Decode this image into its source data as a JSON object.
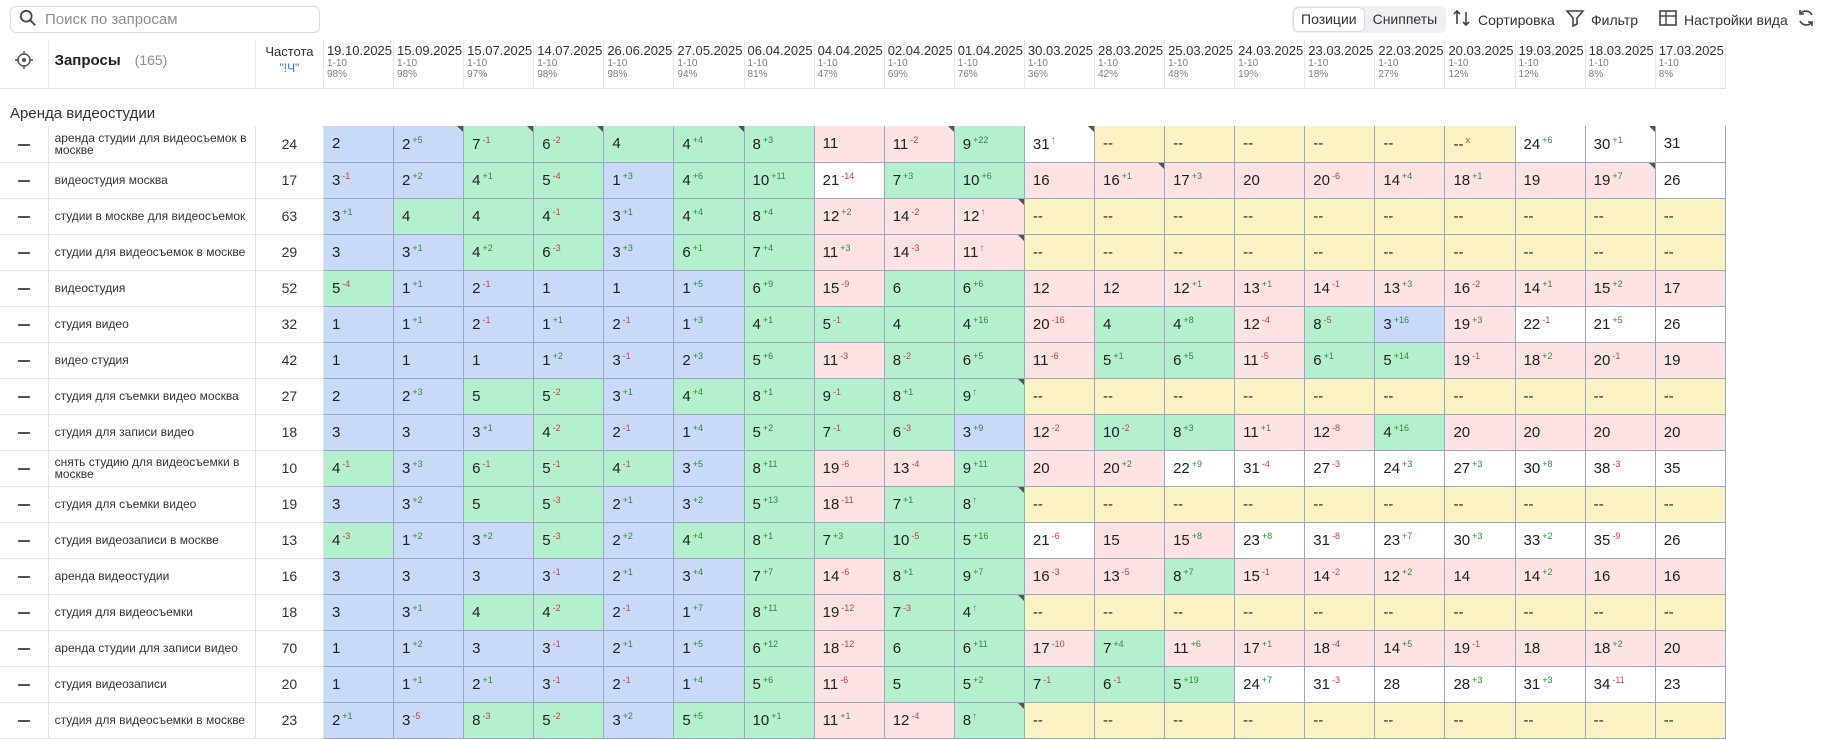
{
  "search": {
    "placeholder": "Поиск по запросам"
  },
  "view_toggle": {
    "positions": "Позиции",
    "snippets": "Сниппеты"
  },
  "toolbar": {
    "sort": "Сортировка",
    "filter": "Фильтр",
    "view_settings": "Настройки вида"
  },
  "header": {
    "query_title": "Запросы",
    "query_count": "(165)",
    "freq_title": "Частота",
    "freq_sub": "\"!Ч\"",
    "dates": [
      {
        "date": "19.10.2025",
        "range": "1-10",
        "pct": "98%"
      },
      {
        "date": "15.09.2025",
        "range": "1-10",
        "pct": "98%"
      },
      {
        "date": "15.07.2025",
        "range": "1-10",
        "pct": "97%"
      },
      {
        "date": "14.07.2025",
        "range": "1-10",
        "pct": "98%"
      },
      {
        "date": "26.06.2025",
        "range": "1-10",
        "pct": "98%"
      },
      {
        "date": "27.05.2025",
        "range": "1-10",
        "pct": "94%"
      },
      {
        "date": "06.04.2025",
        "range": "1-10",
        "pct": "81%"
      },
      {
        "date": "04.04.2025",
        "range": "1-10",
        "pct": "47%"
      },
      {
        "date": "02.04.2025",
        "range": "1-10",
        "pct": "69%"
      },
      {
        "date": "01.04.2025",
        "range": "1-10",
        "pct": "76%"
      },
      {
        "date": "30.03.2025",
        "range": "1-10",
        "pct": "36%"
      },
      {
        "date": "28.03.2025",
        "range": "1-10",
        "pct": "42%"
      },
      {
        "date": "25.03.2025",
        "range": "1-10",
        "pct": "48%"
      },
      {
        "date": "24.03.2025",
        "range": "1-10",
        "pct": "19%"
      },
      {
        "date": "23.03.2025",
        "range": "1-10",
        "pct": "18%"
      },
      {
        "date": "22.03.2025",
        "range": "1-10",
        "pct": "27%"
      },
      {
        "date": "20.03.2025",
        "range": "1-10",
        "pct": "12%"
      },
      {
        "date": "19.03.2025",
        "range": "1-10",
        "pct": "12%"
      },
      {
        "date": "18.03.2025",
        "range": "1-10",
        "pct": "8%"
      },
      {
        "date": "17.03.2025",
        "range": "1-10",
        "pct": "8%"
      }
    ]
  },
  "group": {
    "title": "Аренда видеостудии"
  },
  "colors": {
    "blue": "#c9daf8",
    "green": "#b4f0cd",
    "pink": "#fde3e3",
    "yellow": "#fbf3c3",
    "white": "#ffffff"
  },
  "rows": [
    {
      "query": "аренда студии для видеосъемок в москве",
      "freq": "24",
      "cells": [
        "2",
        "2|+5|c",
        "7|-1|c",
        "6|-2|c",
        "4",
        "4|+4|c",
        "8|+3",
        "11",
        "11|-2|c",
        "9|+22",
        "31|^|c",
        "--",
        "--",
        "--",
        "--",
        "--",
        "--|x",
        "24|+6",
        "30|+1|c",
        "31"
      ]
    },
    {
      "query": "видеостудия москва",
      "freq": "17",
      "cells": [
        "3|-1",
        "2|+2",
        "4|+1",
        "5|-4",
        "1|+3",
        "4|+6",
        "10|+11",
        "21|-14",
        "7|+3",
        "10|+6",
        "16",
        "16|+1|c",
        "17|+3",
        "20",
        "20|-6",
        "14|+4",
        "18|+1",
        "19",
        "19|+7|c",
        "26"
      ]
    },
    {
      "query": "студии в москве для видеосъемок",
      "freq": "63",
      "cells": [
        "3|+1",
        "4|||c",
        "4",
        "4|-1",
        "3|+1",
        "4|+4",
        "8|+4",
        "12|+2",
        "14|-2",
        "12|^|c",
        "--",
        "--",
        "--",
        "--",
        "--",
        "--",
        "--",
        "--",
        "--",
        "--"
      ]
    },
    {
      "query": "студии для видеосъемок в москве",
      "freq": "29",
      "cells": [
        "3",
        "3|+1",
        "4|+2",
        "6|-3",
        "3|+3",
        "6|+1",
        "7|+4",
        "11|+3",
        "14|-3",
        "11|^|c",
        "--",
        "--",
        "--",
        "--",
        "--",
        "--",
        "--",
        "--",
        "--",
        "--"
      ]
    },
    {
      "query": "видеостудия",
      "freq": "52",
      "cells": [
        "5|-4",
        "1|+1",
        "2|-1",
        "1",
        "1",
        "1|+5",
        "6|+9",
        "15|-9",
        "6",
        "6|+6",
        "12",
        "12",
        "12|+1",
        "13|+1",
        "14|-1",
        "13|+3",
        "16|-2",
        "14|+1",
        "15|+2",
        "17"
      ]
    },
    {
      "query": "студия видео",
      "freq": "32",
      "cells": [
        "1",
        "1|+1",
        "2|-1",
        "1|+1",
        "2|-1",
        "1|+3",
        "4|+1",
        "5|-1",
        "4",
        "4|+16",
        "20|-16",
        "4",
        "4|+8",
        "12|-4",
        "8|-5",
        "3|+16",
        "19|+3",
        "22|-1",
        "21|+5",
        "26"
      ]
    },
    {
      "query": "видео студия",
      "freq": "42",
      "cells": [
        "1",
        "1",
        "1",
        "1|+2",
        "3|-1",
        "2|+3",
        "5|+6",
        "11|-3",
        "8|-2",
        "6|+5",
        "11|-6",
        "5|+1",
        "6|+5",
        "11|-5",
        "6|+1",
        "5|+14",
        "19|-1",
        "18|+2",
        "20|-1",
        "19"
      ]
    },
    {
      "query": "студия для съемки видео москва",
      "freq": "27",
      "cells": [
        "2",
        "2|+3",
        "5",
        "5|-2",
        "3|+1",
        "4|+4",
        "8|+1",
        "9|-1",
        "8|+1",
        "9|^|c",
        "--",
        "--",
        "--",
        "--",
        "--",
        "--",
        "--",
        "--",
        "--",
        "--"
      ]
    },
    {
      "query": "студия для записи видео",
      "freq": "18",
      "cells": [
        "3",
        "3",
        "3|+1",
        "4|-2",
        "2|-1",
        "1|+4",
        "5|+2",
        "7|-1",
        "6|-3",
        "3|+9",
        "12|-2",
        "10|-2",
        "8|+3",
        "11|+1",
        "12|-8",
        "4|+16",
        "20",
        "20",
        "20",
        "20"
      ]
    },
    {
      "query": "снять студию для видеосъемки в москве",
      "freq": "10",
      "cells": [
        "4|-1",
        "3|+3",
        "6|-1",
        "5|-1",
        "4|-1",
        "3|+5",
        "8|+11",
        "19|-6",
        "13|-4",
        "9|+11",
        "20",
        "20|+2",
        "22|+9",
        "31|-4",
        "27|-3",
        "24|+3",
        "27|+3",
        "30|+8",
        "38|-3",
        "35"
      ]
    },
    {
      "query": "студия для съемки видео",
      "freq": "19",
      "cells": [
        "3",
        "3|+2",
        "5",
        "5|-3",
        "2|+1",
        "3|+2",
        "5|+13",
        "18|-11",
        "7|+1",
        "8|^|c",
        "--",
        "--",
        "--",
        "--",
        "--",
        "--",
        "--",
        "--",
        "--",
        "--"
      ]
    },
    {
      "query": "студия видеозаписи в москве",
      "freq": "13",
      "cells": [
        "4|-3",
        "1|+2",
        "3|+2",
        "5|-3",
        "2|+2",
        "4|+4",
        "8|+1",
        "7|+3",
        "10|-5",
        "5|+16",
        "21|-6",
        "15",
        "15|+8",
        "23|+8",
        "31|-8",
        "23|+7",
        "30|+3",
        "33|+2",
        "35|-9",
        "26"
      ]
    },
    {
      "query": "аренда видеостудии",
      "freq": "16",
      "cells": [
        "3",
        "3",
        "3",
        "3|-1",
        "2|+1",
        "3|+4",
        "7|+7",
        "14|-6",
        "8|+1",
        "9|+7",
        "16|-3",
        "13|-5",
        "8|+7",
        "15|-1",
        "14|-2",
        "12|+2",
        "14",
        "14|+2",
        "16",
        "16"
      ]
    },
    {
      "query": "студия для видеосъемки",
      "freq": "18",
      "cells": [
        "3",
        "3|+1",
        "4",
        "4|-2",
        "2|-1",
        "1|+7",
        "8|+11",
        "19|-12",
        "7|-3",
        "4|^|c",
        "--",
        "--",
        "--",
        "--",
        "--",
        "--",
        "--",
        "--",
        "--",
        "--"
      ]
    },
    {
      "query": "аренда студии для записи видео",
      "freq": "70",
      "cells": [
        "1",
        "1|+2",
        "3",
        "3|-1",
        "2|+1",
        "1|+5",
        "6|+12",
        "18|-12",
        "6",
        "6|+11",
        "17|-10",
        "7|+4",
        "11|+6",
        "17|+1",
        "18|-4",
        "14|+5",
        "19|-1",
        "18",
        "18|+2",
        "20"
      ]
    },
    {
      "query": "студия видеозаписи",
      "freq": "20",
      "cells": [
        "1",
        "1|+1",
        "2|+1",
        "3|-1",
        "2|-1",
        "1|+4",
        "5|+6",
        "11|-6",
        "5",
        "5|+2",
        "7|-1",
        "6|-1",
        "5|+19",
        "24|+7",
        "31|-3",
        "28",
        "28|+3",
        "31|+3",
        "34|-11",
        "23"
      ]
    },
    {
      "query": "студия для видеосъемки в москве",
      "freq": "23",
      "cells": [
        "2|+1",
        "3|-5",
        "8|-3",
        "5|-2",
        "3|+2",
        "5|+5",
        "10|+1",
        "11|+1",
        "12|-4",
        "8|^|c",
        "--",
        "--",
        "--",
        "--",
        "--",
        "--",
        "--",
        "--",
        "--",
        "--"
      ]
    }
  ]
}
